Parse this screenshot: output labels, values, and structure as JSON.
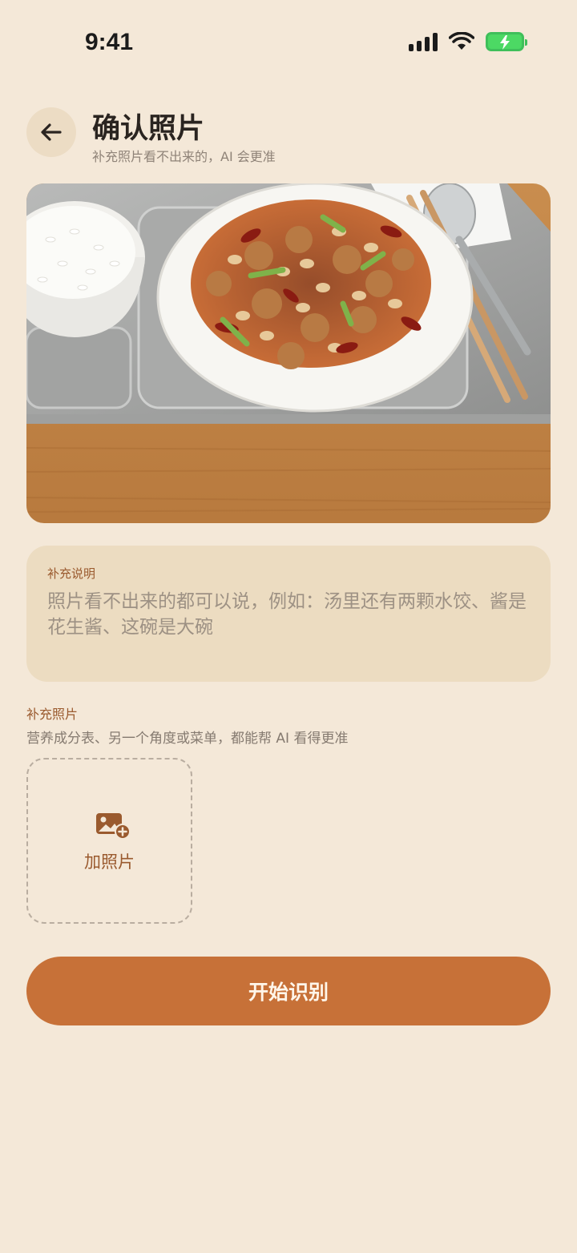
{
  "status_bar": {
    "time": "9:41"
  },
  "header": {
    "title": "确认照片",
    "subtitle": "补充照片看不出来的，AI 会更准"
  },
  "photo": {
    "description": "food-photo-kung-pao-chicken"
  },
  "note": {
    "label": "补充说明",
    "placeholder": "照片看不出来的都可以说，例如：汤里还有两颗水饺、酱是花生酱、这碗是大碗"
  },
  "extra_photos": {
    "label": "补充照片",
    "hint": "营养成分表、另一个角度或菜单，都能帮 AI 看得更准",
    "add_label": "加照片"
  },
  "actions": {
    "start_label": "开始识别"
  },
  "colors": {
    "background": "#f4e8d8",
    "accent": "#c77138",
    "card": "#ecdcc1",
    "label_brown": "#9a5a2e"
  },
  "icons": [
    "back-arrow-icon",
    "signal-icon",
    "wifi-icon",
    "battery-icon",
    "add-photo-icon"
  ]
}
